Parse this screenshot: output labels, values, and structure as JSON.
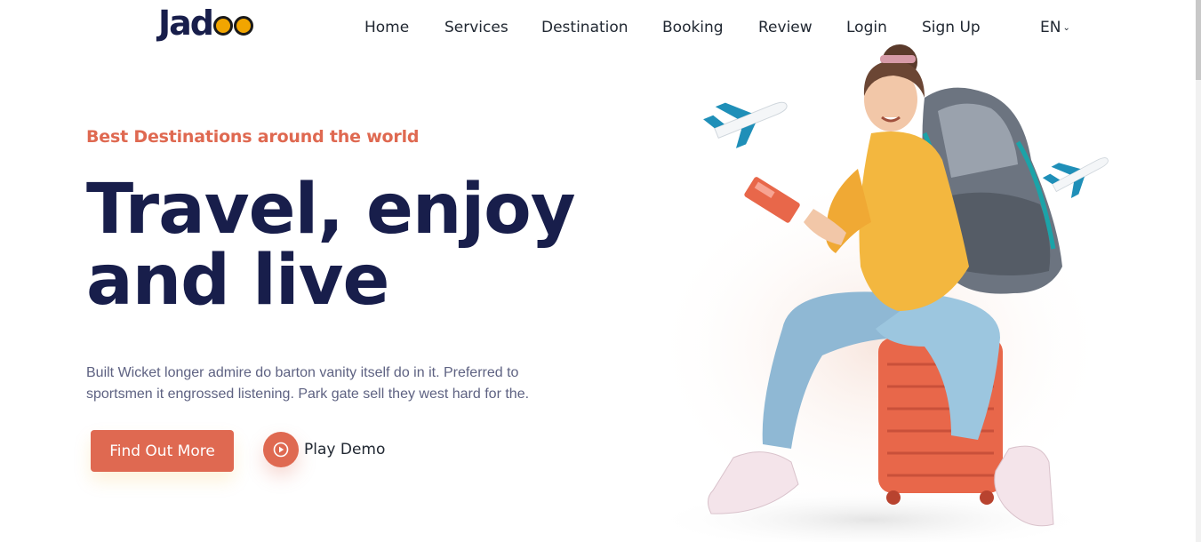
{
  "brand": {
    "name": "Jadoo"
  },
  "nav": {
    "items": [
      {
        "label": "Home"
      },
      {
        "label": "Services"
      },
      {
        "label": "Destination"
      },
      {
        "label": "Booking"
      },
      {
        "label": "Review"
      },
      {
        "label": "Login"
      },
      {
        "label": "Sign Up"
      }
    ],
    "language": "EN"
  },
  "hero": {
    "tagline": "Best Destinations around the world",
    "headline_line1": "Travel, enjoy",
    "headline_line2": "and live",
    "description": "Built Wicket longer admire do barton vanity itself do in it. Preferred to sportsmen it engrossed listening. Park gate sell they west hard for the.",
    "primary_button": "Find Out More",
    "play_button": "Play Demo",
    "image_icon": "traveler-with-backpack-on-suitcase-illustration"
  },
  "colors": {
    "accent": "#DF6951",
    "heading": "#181E4B",
    "body_text": "#5E6282",
    "logo_dot": "#F1A501"
  }
}
